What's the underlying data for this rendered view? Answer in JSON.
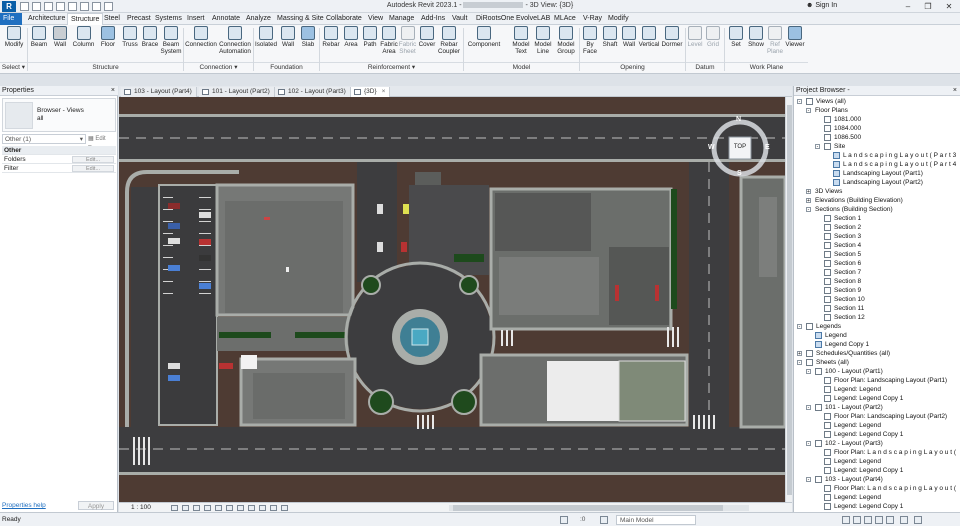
{
  "titlebar": {
    "app_letter": "R",
    "title": "Autodesk Revit 2023.1 - ",
    ".title2": "",
    "view_title": "- 3D View: {3D}",
    "signin": "Sign In",
    "minimize": "–",
    "maximize": "❐",
    "close": "✕"
  },
  "menu": [
    "File",
    "Architecture",
    "Structure",
    "Steel",
    "Precast",
    "Systems",
    "Insert",
    "Annotate",
    "Analyze",
    "Massing & Site",
    "Collaborate",
    "View",
    "Manage",
    "Add-Ins",
    "Vault",
    "DiRootsOne",
    "EvolveLAB",
    "MLAce",
    "V-Ray",
    "Modify"
  ],
  "ribbon": {
    "tools": [
      "Modify",
      "Beam",
      "Wall",
      "Column",
      "Floor",
      "Truss",
      "Brace",
      "Beam System",
      "Connection",
      "Connection Automation",
      "Isolated",
      "Wall",
      "Slab",
      "Rebar",
      "Area",
      "Path",
      "Fabric Area",
      "Fabric Sheet",
      "Cover",
      "Rebar Coupler",
      "Component",
      "Model Text",
      "Model Line",
      "Model Group",
      "By Face",
      "Shaft",
      "Wall",
      "Vertical",
      "Dormer",
      "Level",
      "Grid",
      "Set",
      "Show",
      "Ref Plane",
      "Viewer"
    ],
    "groups": [
      "Select ▾",
      "Structure",
      "Connection ▾",
      "Foundation",
      "Reinforcement ▾",
      "Model",
      "Opening",
      "Datum",
      "Work Plane"
    ]
  },
  "properties": {
    "title": "Properties",
    "close": "×",
    "type_label": "Browser - Views",
    "type_value": "all",
    "filter_value": "Other (1)",
    "edit_type": "Edit Type",
    "category": "Other",
    "rows": [
      {
        "label": "Folders",
        "button": "Edit..."
      },
      {
        "label": "Filter",
        "button": "Edit..."
      }
    ],
    "help": "Properties help",
    "apply": "Apply"
  },
  "tabs": [
    {
      "label": "103 - Layout (Part4)",
      "close": "×"
    },
    {
      "label": "101 - Layout (Part2)",
      "close": "×"
    },
    {
      "label": "102 - Layout (Part3)",
      "close": "×"
    },
    {
      "label": "{3D}",
      "close": "×"
    }
  ],
  "view_cube": {
    "face": "TOP",
    "n": "N",
    "s": "S",
    "e": "E",
    "w": "W"
  },
  "viewbar": {
    "scale": "1 : 100"
  },
  "project_browser": {
    "title": "Project Browser -",
    "close": "×",
    "nodes": [
      {
        "label": "Views (all)",
        "depth": 0,
        "toggle": "-",
        "icon": "view"
      },
      {
        "label": "Floor Plans",
        "depth": 1,
        "toggle": "-",
        "icon": ""
      },
      {
        "label": "1081.000",
        "depth": 2,
        "toggle": "",
        "icon": "plan"
      },
      {
        "label": "1084.000",
        "depth": 2,
        "toggle": "",
        "icon": "plan"
      },
      {
        "label": "1086.500",
        "depth": 2,
        "toggle": "",
        "icon": "plan"
      },
      {
        "label": "Site",
        "depth": 2,
        "toggle": "-",
        "icon": "plan"
      },
      {
        "label": "L a n d s c a p i n g  L a y o u t  ( P a r t 3",
        "depth": 3,
        "toggle": "",
        "icon": "sel"
      },
      {
        "label": "L a n d s c a p i n g  L a y o u t  ( P a r t 4",
        "depth": 3,
        "toggle": "",
        "icon": "sel"
      },
      {
        "label": "Landscaping Layout (Part1)",
        "depth": 3,
        "toggle": "",
        "icon": "sel"
      },
      {
        "label": "Landscaping Layout (Part2)",
        "depth": 3,
        "toggle": "",
        "icon": "sel"
      },
      {
        "label": "3D Views",
        "depth": 1,
        "toggle": "+",
        "icon": ""
      },
      {
        "label": "Elevations (Building Elevation)",
        "depth": 1,
        "toggle": "+",
        "icon": ""
      },
      {
        "label": "Sections (Building Section)",
        "depth": 1,
        "toggle": "-",
        "icon": ""
      },
      {
        "label": "Section 1",
        "depth": 2,
        "toggle": "",
        "icon": "plan"
      },
      {
        "label": "Section 2",
        "depth": 2,
        "toggle": "",
        "icon": "plan"
      },
      {
        "label": "Section 3",
        "depth": 2,
        "toggle": "",
        "icon": "plan"
      },
      {
        "label": "Section 4",
        "depth": 2,
        "toggle": "",
        "icon": "plan"
      },
      {
        "label": "Section 5",
        "depth": 2,
        "toggle": "",
        "icon": "plan"
      },
      {
        "label": "Section 6",
        "depth": 2,
        "toggle": "",
        "icon": "plan"
      },
      {
        "label": "Section 7",
        "depth": 2,
        "toggle": "",
        "icon": "plan"
      },
      {
        "label": "Section 8",
        "depth": 2,
        "toggle": "",
        "icon": "plan"
      },
      {
        "label": "Section 9",
        "depth": 2,
        "toggle": "",
        "icon": "plan"
      },
      {
        "label": "Section 10",
        "depth": 2,
        "toggle": "",
        "icon": "plan"
      },
      {
        "label": "Section 11",
        "depth": 2,
        "toggle": "",
        "icon": "plan"
      },
      {
        "label": "Section 12",
        "depth": 2,
        "toggle": "",
        "icon": "plan"
      },
      {
        "label": "Legends",
        "depth": 0,
        "toggle": "-",
        "icon": "legend"
      },
      {
        "label": "Legend",
        "depth": 1,
        "toggle": "",
        "icon": "sel"
      },
      {
        "label": "Legend Copy 1",
        "depth": 1,
        "toggle": "",
        "icon": "sel"
      },
      {
        "label": "Schedules/Quantities (all)",
        "depth": 0,
        "toggle": "+",
        "icon": "legend"
      },
      {
        "label": "Sheets (all)",
        "depth": 0,
        "toggle": "-",
        "icon": "legend"
      },
      {
        "label": "100 - Layout (Part1)",
        "depth": 1,
        "toggle": "-",
        "icon": "legend"
      },
      {
        "label": "Floor Plan: Landscaping Layout (Part1)",
        "depth": 2,
        "toggle": "",
        "icon": "legend"
      },
      {
        "label": "Legend: Legend",
        "depth": 2,
        "toggle": "",
        "icon": "legend"
      },
      {
        "label": "Legend: Legend Copy 1",
        "depth": 2,
        "toggle": "",
        "icon": "legend"
      },
      {
        "label": "101 - Layout (Part2)",
        "depth": 1,
        "toggle": "-",
        "icon": "legend"
      },
      {
        "label": "Floor Plan: Landscaping Layout (Part2)",
        "depth": 2,
        "toggle": "",
        "icon": "legend"
      },
      {
        "label": "Legend: Legend",
        "depth": 2,
        "toggle": "",
        "icon": "legend"
      },
      {
        "label": "Legend: Legend Copy 1",
        "depth": 2,
        "toggle": "",
        "icon": "legend"
      },
      {
        "label": "102 - Layout (Part3)",
        "depth": 1,
        "toggle": "-",
        "icon": "legend"
      },
      {
        "label": "Floor Plan: L a n d s c a p i n g  L a y o u t  (",
        "depth": 2,
        "toggle": "",
        "icon": "legend"
      },
      {
        "label": "Legend: Legend",
        "depth": 2,
        "toggle": "",
        "icon": "legend"
      },
      {
        "label": "Legend: Legend Copy 1",
        "depth": 2,
        "toggle": "",
        "icon": "legend"
      },
      {
        "label": "103 - Layout (Part4)",
        "depth": 1,
        "toggle": "-",
        "icon": "legend"
      },
      {
        "label": "Floor Plan: L a n d s c a p i n g  L a y o u t  (",
        "depth": 2,
        "toggle": "",
        "icon": "legend"
      },
      {
        "label": "Legend: Legend",
        "depth": 2,
        "toggle": "",
        "icon": "legend"
      },
      {
        "label": "Legend: Legend Copy 1",
        "depth": 2,
        "toggle": "",
        "icon": "legend"
      }
    ]
  },
  "status": {
    "ready": "Ready",
    "zero": ":0",
    "workset": "Main Model"
  },
  "colors": {
    "road": "#3d3d3f",
    "soil": "#4e3b33",
    "curb": "#a9ada9",
    "building": "#6c6f6c",
    "green": "#1d4a1c",
    "water": "#4aa9c3",
    "accent": "#1f6fc0"
  }
}
